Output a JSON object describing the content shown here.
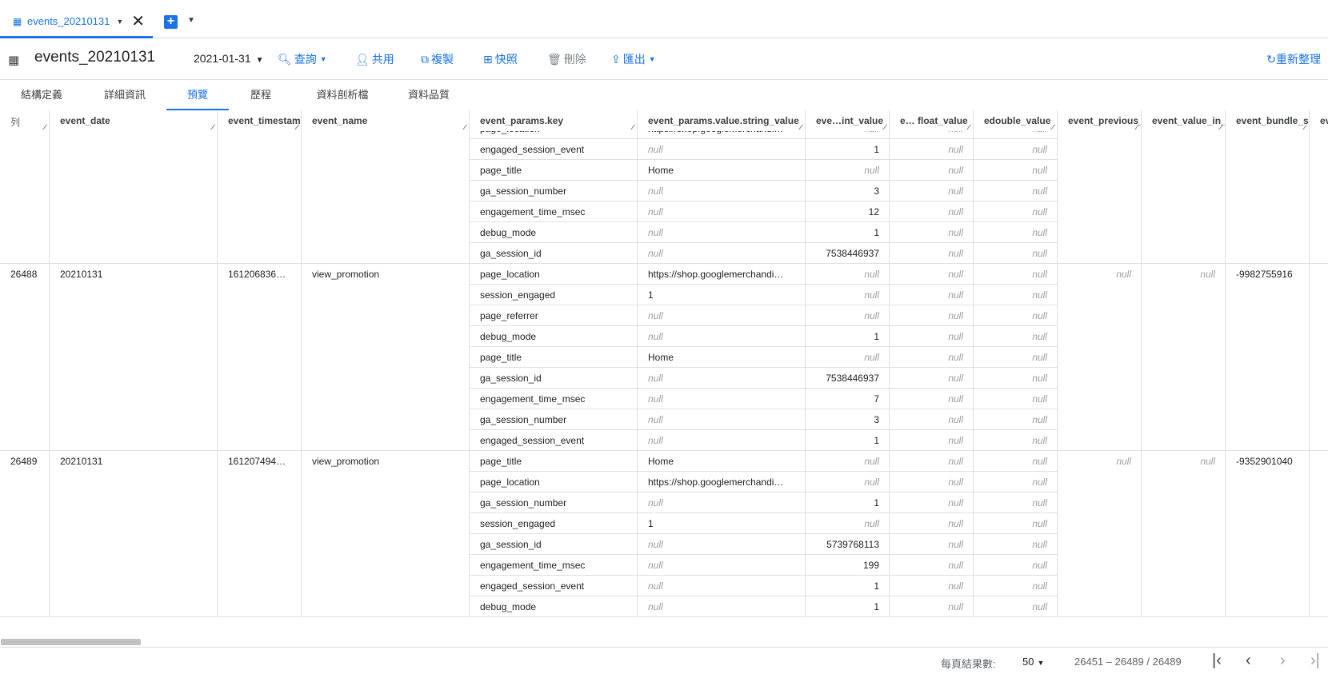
{
  "tab": {
    "label": "events_20210131"
  },
  "toolbar": {
    "title": "events_20210131",
    "date": "2021-01-31",
    "query": "查詢",
    "share": "共用",
    "copy": "複製",
    "snapshot": "快照",
    "delete": "刪除",
    "export": "匯出",
    "refresh": "重新整理"
  },
  "subtabs": [
    "結構定義",
    "詳細資訊",
    "預覽",
    "歷程",
    "資料剖析檔",
    "資料品質"
  ],
  "active_subtab": "預覽",
  "columns": [
    "列",
    "event_date",
    "event_timestam",
    "event_name",
    "event_params.key",
    "event_params.value.string_value",
    "eve…int_value",
    "e… float_value",
    "edouble_value",
    "event_previous_",
    "event_value_in_u",
    "event_bundle_se",
    "ev"
  ],
  "null_text": "null",
  "groups": [
    {
      "row": "",
      "event_date": "",
      "event_timestamp": "",
      "event_name": "",
      "extra": [
        "",
        "",
        ""
      ],
      "params": [
        [
          "page_location",
          "https://shop.googlemerchandi…",
          "null",
          "null",
          "null"
        ],
        [
          "engaged_session_event",
          "null",
          "1",
          "null",
          "null"
        ],
        [
          "page_title",
          "Home",
          "null",
          "null",
          "null"
        ],
        [
          "ga_session_number",
          "null",
          "3",
          "null",
          "null"
        ],
        [
          "engagement_time_msec",
          "null",
          "12",
          "null",
          "null"
        ],
        [
          "debug_mode",
          "null",
          "1",
          "null",
          "null"
        ],
        [
          "ga_session_id",
          "null",
          "7538446937",
          "null",
          "null"
        ]
      ]
    },
    {
      "row": "26488",
      "event_date": "20210131",
      "event_timestamp": "161206836…",
      "event_name": "view_promotion",
      "extra": [
        "null",
        "null",
        "-9982755916"
      ],
      "params": [
        [
          "page_location",
          "https://shop.googlemerchandi…",
          "null",
          "null",
          "null"
        ],
        [
          "session_engaged",
          "1",
          "null",
          "null",
          "null"
        ],
        [
          "page_referrer",
          "null",
          "null",
          "null",
          "null"
        ],
        [
          "debug_mode",
          "null",
          "1",
          "null",
          "null"
        ],
        [
          "page_title",
          "Home",
          "null",
          "null",
          "null"
        ],
        [
          "ga_session_id",
          "null",
          "7538446937",
          "null",
          "null"
        ],
        [
          "engagement_time_msec",
          "null",
          "7",
          "null",
          "null"
        ],
        [
          "ga_session_number",
          "null",
          "3",
          "null",
          "null"
        ],
        [
          "engaged_session_event",
          "null",
          "1",
          "null",
          "null"
        ]
      ]
    },
    {
      "row": "26489",
      "event_date": "20210131",
      "event_timestamp": "161207494…",
      "event_name": "view_promotion",
      "extra": [
        "null",
        "null",
        "-9352901040"
      ],
      "params": [
        [
          "page_title",
          "Home",
          "null",
          "null",
          "null"
        ],
        [
          "page_location",
          "https://shop.googlemerchandi…",
          "null",
          "null",
          "null"
        ],
        [
          "ga_session_number",
          "null",
          "1",
          "null",
          "null"
        ],
        [
          "session_engaged",
          "1",
          "null",
          "null",
          "null"
        ],
        [
          "ga_session_id",
          "null",
          "5739768113",
          "null",
          "null"
        ],
        [
          "engagement_time_msec",
          "null",
          "199",
          "null",
          "null"
        ],
        [
          "engaged_session_event",
          "null",
          "1",
          "null",
          "null"
        ],
        [
          "debug_mode",
          "null",
          "1",
          "null",
          "null"
        ]
      ]
    }
  ],
  "footer": {
    "per_page_label": "每頁結果數:",
    "per_page": "50",
    "range": "26451 – 26489 / 26489"
  },
  "icons": [
    "table-icon",
    "close-icon",
    "add-tab-icon",
    "chevron-down-icon",
    "search-icon",
    "person-add-icon",
    "copy-icon",
    "snapshot-icon",
    "trash-icon",
    "export-icon",
    "refresh-icon",
    "first-page-icon",
    "prev-page-icon",
    "next-page-icon",
    "last-page-icon"
  ]
}
